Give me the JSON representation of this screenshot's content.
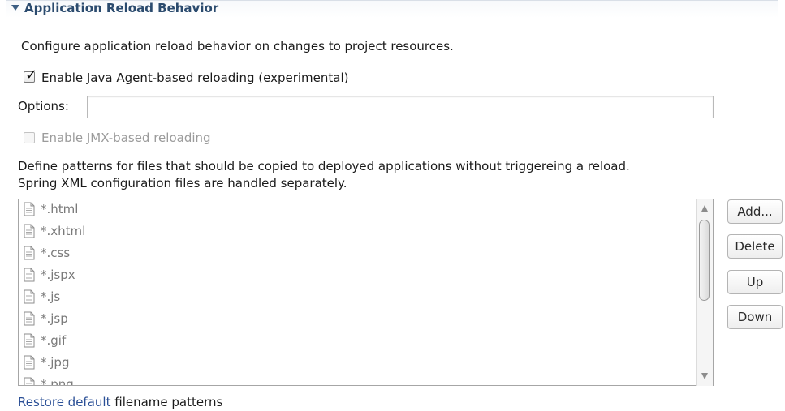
{
  "section": {
    "title": "Application Reload Behavior",
    "description": "Configure application reload behavior on changes to project resources."
  },
  "java_agent": {
    "label": "Enable Java Agent-based reloading (experimental)",
    "checked": true
  },
  "options": {
    "label": "Options:",
    "value": ""
  },
  "jmx": {
    "label": "Enable JMX-based reloading",
    "checked": false,
    "enabled": false
  },
  "patterns": {
    "description_line1": "Define patterns for files that should be copied to deployed applications without triggereing a reload.",
    "description_line2": "Spring XML configuration files are handled separately.",
    "items": [
      "*.html",
      "*.xhtml",
      "*.css",
      "*.jspx",
      "*.js",
      "*.jsp",
      "*.gif",
      "*.jpg",
      "*.png"
    ],
    "item_icon": "document-icon"
  },
  "buttons": {
    "add": "Add...",
    "delete": "Delete",
    "up": "Up",
    "down": "Down"
  },
  "footer": {
    "link": "Restore default",
    "text": "filename patterns"
  },
  "colors": {
    "header_text": "#2b4b6e",
    "link": "#2a4f96",
    "list_text": "#7a7a7a"
  }
}
